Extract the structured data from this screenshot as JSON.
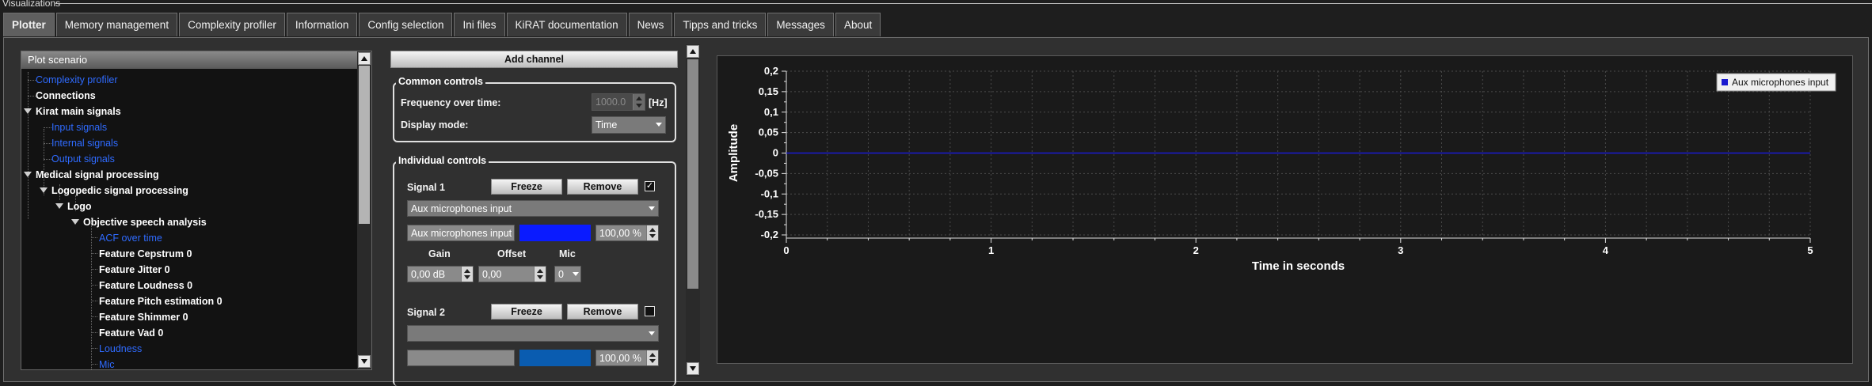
{
  "window": {
    "title": "Visualizations"
  },
  "tabs": [
    {
      "label": "Plotter"
    },
    {
      "label": "Memory management"
    },
    {
      "label": "Complexity profiler"
    },
    {
      "label": "Information"
    },
    {
      "label": "Config selection"
    },
    {
      "label": "Ini files"
    },
    {
      "label": "KiRAT documentation"
    },
    {
      "label": "News"
    },
    {
      "label": "Tipps and tricks"
    },
    {
      "label": "Messages"
    },
    {
      "label": "About"
    }
  ],
  "tree": {
    "header": "Plot scenario",
    "items": [
      {
        "label": "Complexity profiler"
      },
      {
        "label": "Connections"
      },
      {
        "label": "Kirat main signals"
      },
      {
        "label": "Input signals"
      },
      {
        "label": "Internal signals"
      },
      {
        "label": "Output signals"
      },
      {
        "label": "Medical signal processing"
      },
      {
        "label": "Logopedic signal processing"
      },
      {
        "label": "Logo"
      },
      {
        "label": "Objective speech analysis"
      },
      {
        "label": "ACF over time"
      },
      {
        "label": "Feature Cepstrum 0"
      },
      {
        "label": "Feature Jitter 0"
      },
      {
        "label": "Feature Loudness 0"
      },
      {
        "label": "Feature Pitch estimation 0"
      },
      {
        "label": "Feature Shimmer 0"
      },
      {
        "label": "Feature Vad 0"
      },
      {
        "label": "Loudness"
      },
      {
        "label": "Mic"
      }
    ]
  },
  "controls": {
    "add_channel": "Add channel",
    "common": {
      "title": "Common controls",
      "freq_label": "Frequency over time:",
      "freq_value": "1000.0",
      "freq_unit": "[Hz]",
      "display_label": "Display mode:",
      "display_value": "Time"
    },
    "individual": {
      "title": "Individual controls",
      "signal1": {
        "label": "Signal 1",
        "freeze": "Freeze",
        "remove": "Remove",
        "checked": "✓",
        "source": "Aux microphones input",
        "name": "Aux microphones input",
        "color": "#0a1bff",
        "percent": "100,00 %",
        "gain_label": "Gain",
        "offset_label": "Offset",
        "mic_label": "Mic",
        "gain": "0,00 dB",
        "offset": "0,00",
        "mic": "0"
      },
      "signal2": {
        "label": "Signal 2",
        "freeze": "Freeze",
        "remove": "Remove",
        "source": "",
        "name": "",
        "color": "#0a5cb0",
        "percent": "100,00 %"
      }
    }
  },
  "chart_data": {
    "type": "line",
    "title": "",
    "xlabel": "Time in seconds",
    "ylabel": "Amplitude",
    "xlim": [
      0,
      5
    ],
    "ylim": [
      -0.2,
      0.2
    ],
    "x_ticks": [
      "0",
      "1",
      "2",
      "3",
      "4",
      "5"
    ],
    "y_ticks": [
      "0,2",
      "0,15",
      "0,1",
      "0,05",
      "0",
      "-0,05",
      "-0,1",
      "-0,15",
      "-0,2"
    ],
    "grid": true,
    "legend_position": "top-right",
    "series": [
      {
        "name": "Aux microphones input",
        "color": "#1a1ad0",
        "x": [
          0,
          5
        ],
        "y": [
          0,
          0
        ]
      }
    ]
  }
}
